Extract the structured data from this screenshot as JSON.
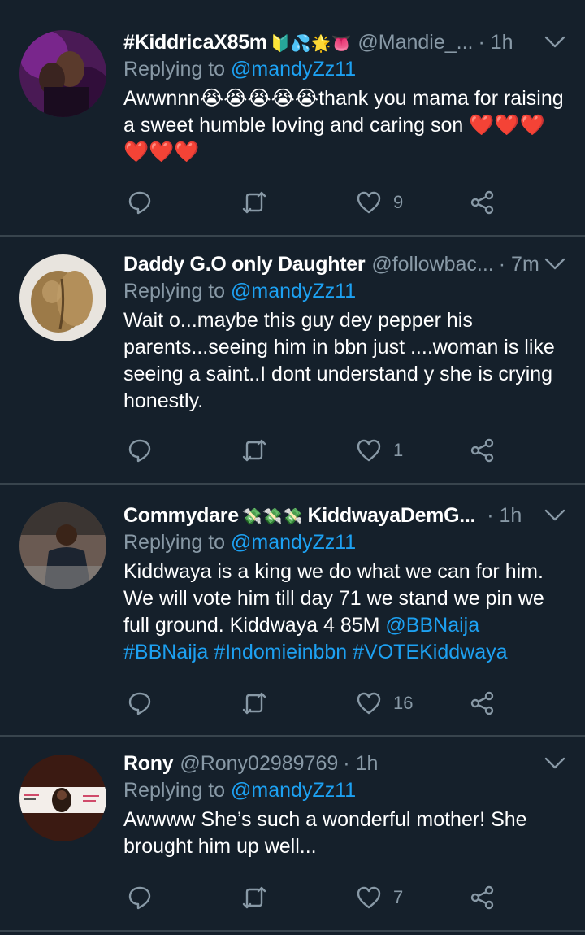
{
  "tweets": [
    {
      "name": "#KiddricaX85m",
      "emoji": "🔰💦🌟👅",
      "handle": "@Mandie_...",
      "time": "· 1h",
      "replying_label": "Replying to",
      "replying_to": "@mandyZz11",
      "text": "Awwnnn😭😭😭😭😭thank you mama for raising a sweet humble loving and caring son ❤️❤️❤️❤️❤️❤️",
      "likes": "9"
    },
    {
      "name": "Daddy G.O only Daughter",
      "handle": "@followbac...",
      "time": "· 7m",
      "replying_label": "Replying to",
      "replying_to": "@mandyZz11",
      "text": "Wait o...maybe this guy dey pepper his parents...seeing him in bbn just ....woman is like seeing a saint..I dont understand y she is crying honestly.",
      "likes": "1"
    },
    {
      "name": "Commydare",
      "emoji": "💸💸💸",
      "name_suffix": "KiddwayaDemG...",
      "time": "· 1h",
      "replying_label": "Replying to",
      "replying_to": "@mandyZz11",
      "text": "Kiddwaya is a king we do what we can for him. We will vote him till day 71 we stand we pin we full ground. Kiddwaya 4 85M",
      "link1": "@BBNaija",
      "link2": "#BBNaija",
      "link3": "#Indomieinbbn",
      "link4": "#VOTEKiddwaya",
      "likes": "16"
    },
    {
      "name": "Rony",
      "handle": "@Rony02989769",
      "time": "· 1h",
      "replying_label": "Replying to",
      "replying_to": "@mandyZz11",
      "text": "Awwww She’s such a wonderful mother! She brought him up well...",
      "likes": "7"
    }
  ],
  "colors": {
    "background": "#15202b",
    "divider": "#38444d",
    "secondary_text": "#8899a6",
    "link": "#1da1f2",
    "icon": "#8899a6"
  },
  "icons": [
    "reply-icon",
    "retweet-icon",
    "like-icon",
    "share-icon",
    "chevron-down-icon"
  ]
}
